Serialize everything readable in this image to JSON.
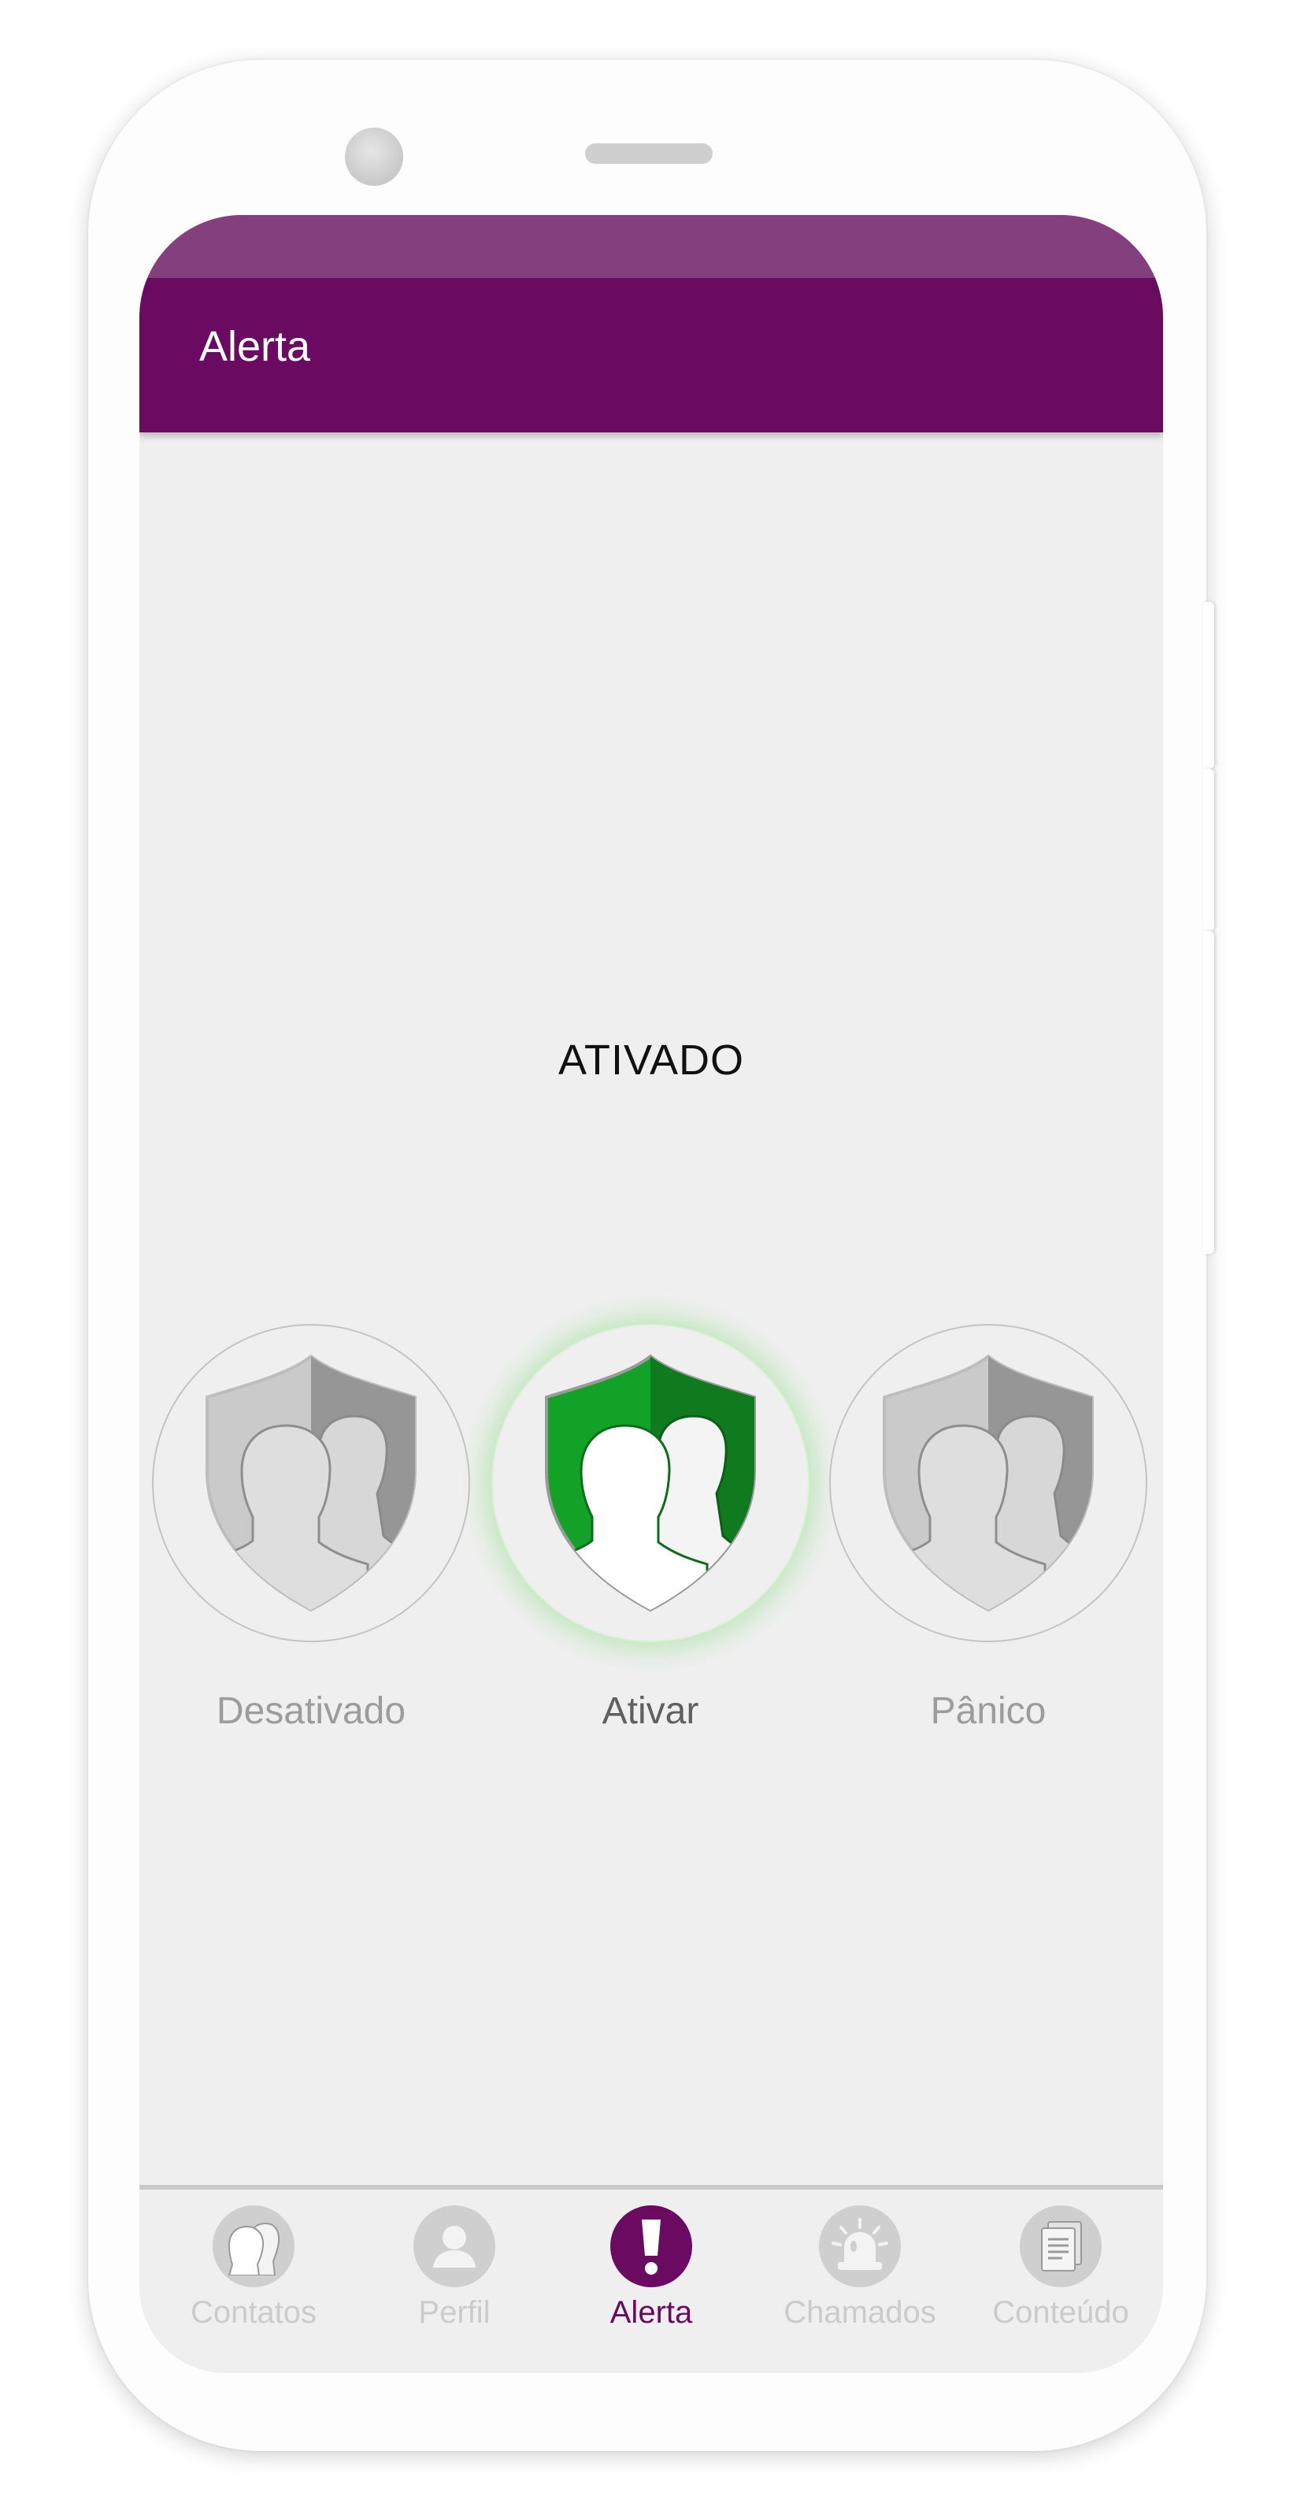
{
  "app_bar": {
    "title": "Alerta",
    "color": "#6a0a60",
    "status_bar_color": "#84407c"
  },
  "status": {
    "text": "ATIVADO"
  },
  "modes": [
    {
      "label": "Desativado",
      "icon": "shield-people-icon",
      "state": "inactive"
    },
    {
      "label": "Ativar",
      "icon": "shield-people-icon",
      "state": "active",
      "color": "#13a228"
    },
    {
      "label": "Pânico",
      "icon": "shield-people-icon",
      "state": "inactive"
    }
  ],
  "bottom_nav": {
    "items": [
      {
        "label": "Contatos",
        "icon": "contacts-icon",
        "active": false
      },
      {
        "label": "Perfil",
        "icon": "profile-icon",
        "active": false
      },
      {
        "label": "Alerta",
        "icon": "alert-icon",
        "active": true
      },
      {
        "label": "Chamados",
        "icon": "siren-icon",
        "active": false
      },
      {
        "label": "Conteúdo",
        "icon": "documents-icon",
        "active": false
      }
    ]
  }
}
